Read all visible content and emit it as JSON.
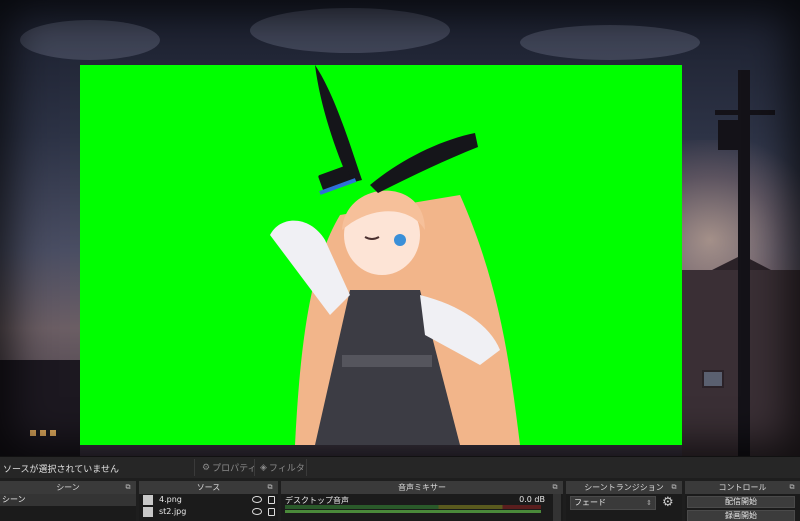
{
  "status": {
    "no_source_selected": "ソースが選択されていません"
  },
  "toolbar": {
    "properties_label": "プロパティ",
    "filters_label": "フィルタ"
  },
  "docks": {
    "scenes": {
      "title": "シーン",
      "items": [
        "シーン"
      ]
    },
    "sources": {
      "title": "ソース",
      "items": [
        {
          "name": "4.png"
        },
        {
          "name": "st2.jpg"
        }
      ]
    },
    "audio_mixer": {
      "title": "音声ミキサー",
      "channels": [
        {
          "name": "デスクトップ音声",
          "level": "0.0 dB"
        }
      ]
    },
    "scene_transitions": {
      "title": "シーントランジション",
      "selected": "フェード"
    },
    "controls": {
      "title": "コントロール",
      "buttons": [
        "配信開始",
        "録画開始"
      ]
    }
  },
  "colors": {
    "chroma_green": "#00ff00",
    "panel_bg": "#272727",
    "dock_title_bg": "#3a3a3a"
  }
}
